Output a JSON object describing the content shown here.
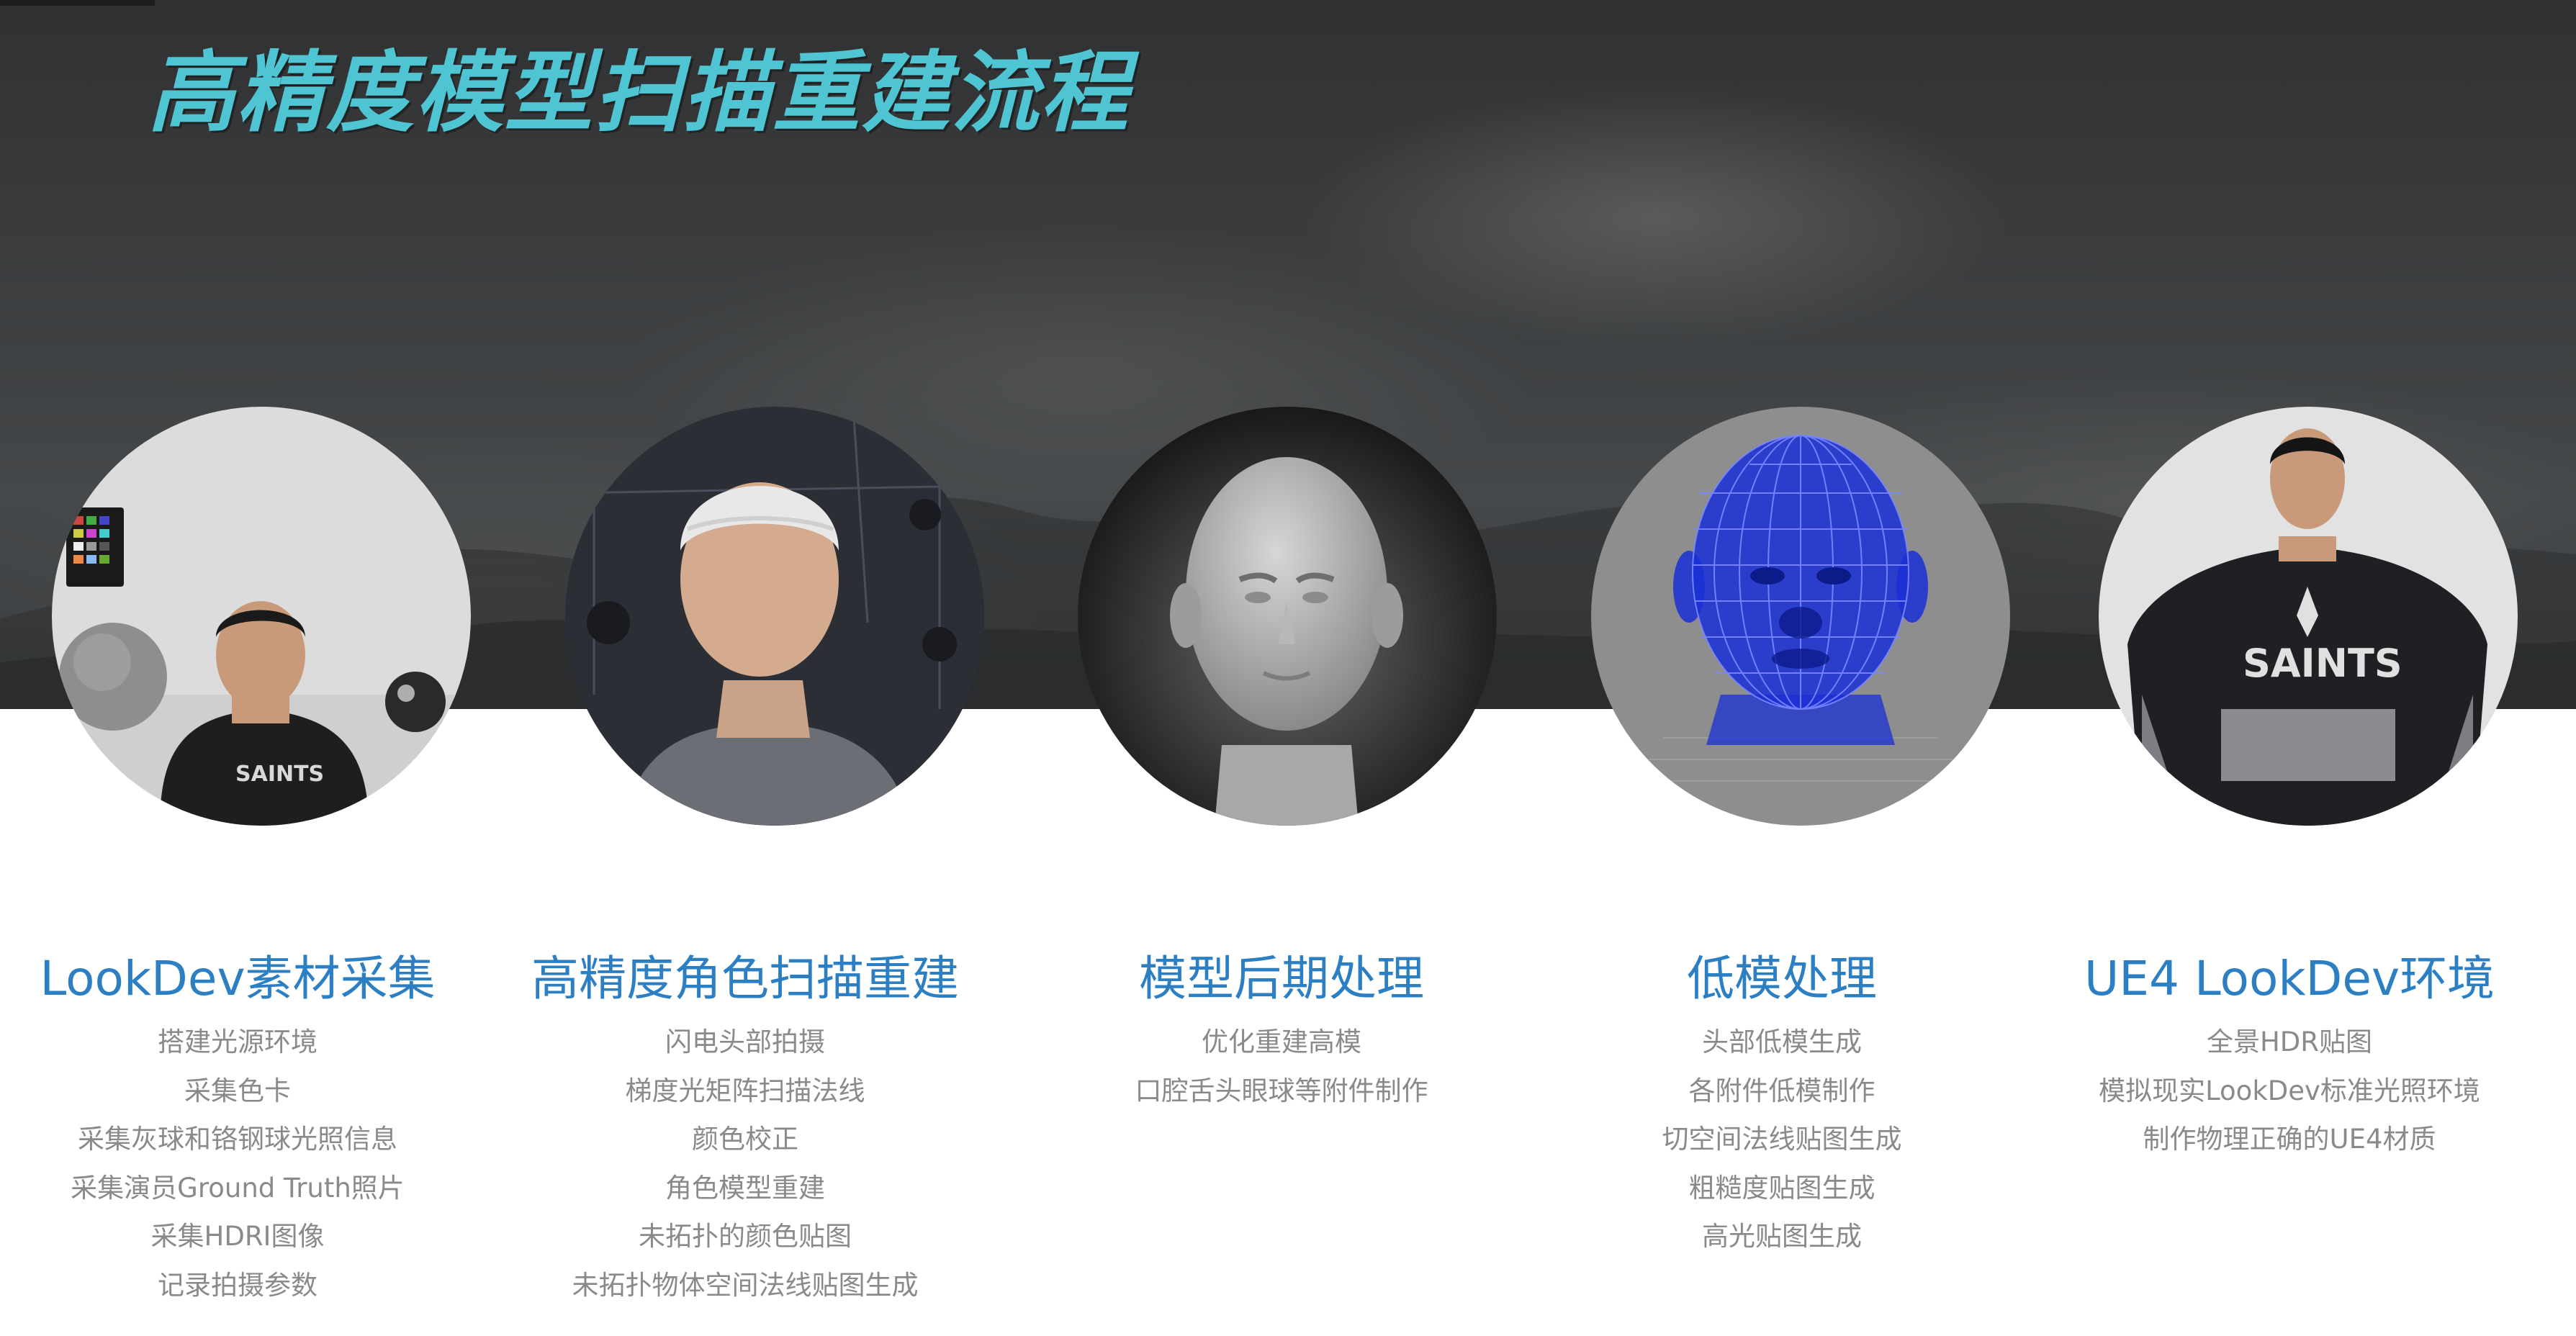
{
  "title": "高精度模型扫描重建流程",
  "steps": [
    {
      "title": "LookDev素材采集",
      "image": "person-holding-color-chart-and-spheres",
      "items": [
        "搭建光源环境",
        "采集色卡",
        "采集灰球和铬钢球光照信息",
        "采集演员Ground Truth照片",
        "采集HDRI图像",
        "记录拍摄参数"
      ]
    },
    {
      "title": "高精度角色扫描重建",
      "image": "person-in-camera-array-with-cap",
      "items": [
        "闪电头部拍摄",
        "梯度光矩阵扫描法线",
        "颜色校正",
        "角色模型重建",
        "未拓扑的颜色贴图",
        "未拓扑物体空间法线贴图生成"
      ]
    },
    {
      "title": "模型后期处理",
      "image": "grey-sculpted-head-model",
      "items": [
        "优化重建高模",
        "口腔舌头眼球等附件制作"
      ]
    },
    {
      "title": "低模处理",
      "image": "blue-wireframe-head-mesh",
      "items": [
        "头部低模生成",
        "各附件低模制作",
        "切空间法线贴图生成",
        "粗糙度贴图生成",
        "高光贴图生成"
      ]
    },
    {
      "title": "UE4 LookDev环境",
      "image": "rendered-character-in-hoodie",
      "items": [
        "全景HDR贴图",
        "模拟现实LookDev标准光照环境",
        "制作物理正确的UE4材质"
      ]
    }
  ],
  "colors": {
    "title": "#4fc5d3",
    "step_title": "#2b7fc2",
    "step_item": "#8a8a8a",
    "band": "#3a3c3e",
    "wireframe": "#1a2fd6"
  }
}
